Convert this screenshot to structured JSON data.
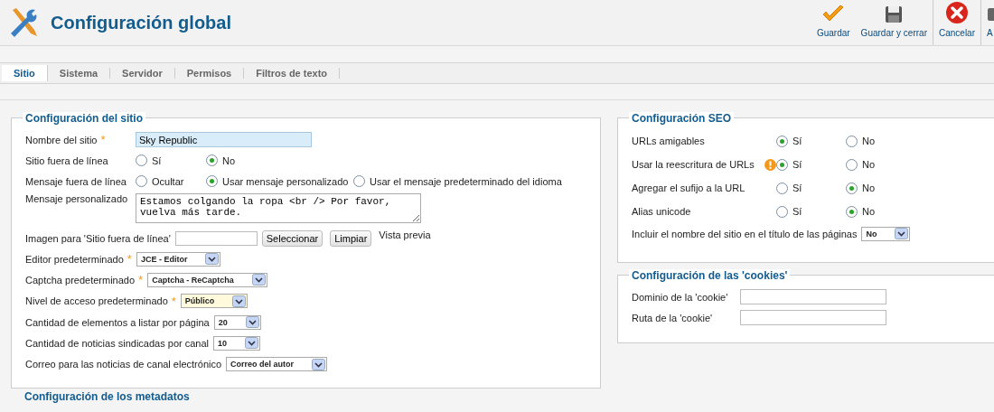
{
  "header": {
    "title": "Configuración global",
    "toolbar": [
      {
        "kind": "save",
        "label": "Guardar"
      },
      {
        "kind": "save-close",
        "label": "Guardar y cerrar"
      },
      {
        "kind": "cancel",
        "label": "Cancelar"
      },
      {
        "kind": "cut",
        "label": "A"
      }
    ]
  },
  "tabs": [
    {
      "label": "Sitio",
      "selected": true
    },
    {
      "label": "Sistema",
      "selected": false
    },
    {
      "label": "Servidor",
      "selected": false
    },
    {
      "label": "Permisos",
      "selected": false
    },
    {
      "label": "Filtros de texto",
      "selected": false
    }
  ],
  "site_settings": {
    "title": "Configuración del sitio",
    "fields": [
      {
        "kind": "text",
        "label": "Nombre del sitio",
        "required_mark": "*",
        "value": "Sky Republic",
        "highlighted": true
      },
      {
        "kind": "radio",
        "label": "Sitio fuera de línea",
        "options": [
          {
            "label": "Sí",
            "selected": false
          },
          {
            "label": "No",
            "selected": true
          }
        ]
      },
      {
        "kind": "radio",
        "label": "Mensaje fuera de línea",
        "options": [
          {
            "label": "Ocultar",
            "selected": false
          },
          {
            "label": "Usar mensaje personalizado",
            "selected": true
          },
          {
            "label": "Usar el mensaje predeterminado del idioma",
            "selected": false
          }
        ]
      },
      {
        "kind": "textarea",
        "label": "Mensaje personalizado",
        "value": "Estamos colgando la ropa <br /> Por favor, vuelva más tarde."
      },
      {
        "kind": "image",
        "label": "Imagen para 'Sitio fuera de línea'",
        "buttons": [
          "Seleccionar",
          "Limpiar"
        ],
        "preview": "Vista previa"
      },
      {
        "kind": "select",
        "label": "Editor predeterminado",
        "required_mark": "*",
        "value": "JCE - Editor",
        "highlighted": false
      },
      {
        "kind": "select",
        "label": "Captcha predeterminado",
        "required_mark": "*",
        "value": "Captcha - ReCaptcha",
        "highlighted": false
      },
      {
        "kind": "select",
        "label": "Nivel de acceso predeterminado",
        "required_mark": "*",
        "value": "Público",
        "highlighted": true
      },
      {
        "kind": "select",
        "label": "Cantidad de elementos a listar por página",
        "value": "20",
        "highlighted": false
      },
      {
        "kind": "select",
        "label": "Cantidad de noticias sindicadas por canal",
        "value": "10",
        "highlighted": false
      },
      {
        "kind": "select",
        "label": "Correo para las noticias de canal electrónico",
        "value": "Correo del autor",
        "highlighted": false
      }
    ]
  },
  "metadata_settings": {
    "title": "Configuración de los metadatos"
  },
  "seo_settings": {
    "title": "Configuración SEO",
    "fields": [
      {
        "kind": "radio",
        "label": "URLs amigables",
        "options": [
          {
            "label": "Sí",
            "selected": true
          },
          {
            "label": "No",
            "selected": false
          }
        ]
      },
      {
        "kind": "radio",
        "label": "Usar la reescritura de URLs",
        "warning": true,
        "options": [
          {
            "label": "Sí",
            "selected": true
          },
          {
            "label": "No",
            "selected": false
          }
        ]
      },
      {
        "kind": "radio",
        "label": "Agregar el sufijo a la URL",
        "options": [
          {
            "label": "Sí",
            "selected": false
          },
          {
            "label": "No",
            "selected": true
          }
        ]
      },
      {
        "kind": "radio",
        "label": "Alias unicode",
        "options": [
          {
            "label": "Sí",
            "selected": false
          },
          {
            "label": "No",
            "selected": true
          }
        ]
      },
      {
        "kind": "select",
        "label": "Incluir el nombre del sitio en el título de las páginas",
        "value": "No",
        "highlighted": false
      }
    ]
  },
  "cookie_settings": {
    "title": "Configuración de las 'cookies'",
    "fields": [
      {
        "kind": "text",
        "label": "Dominio de la 'cookie'",
        "highlighted": false
      },
      {
        "kind": "text",
        "label": "Ruta de la 'cookie'",
        "highlighted": false
      }
    ]
  }
}
